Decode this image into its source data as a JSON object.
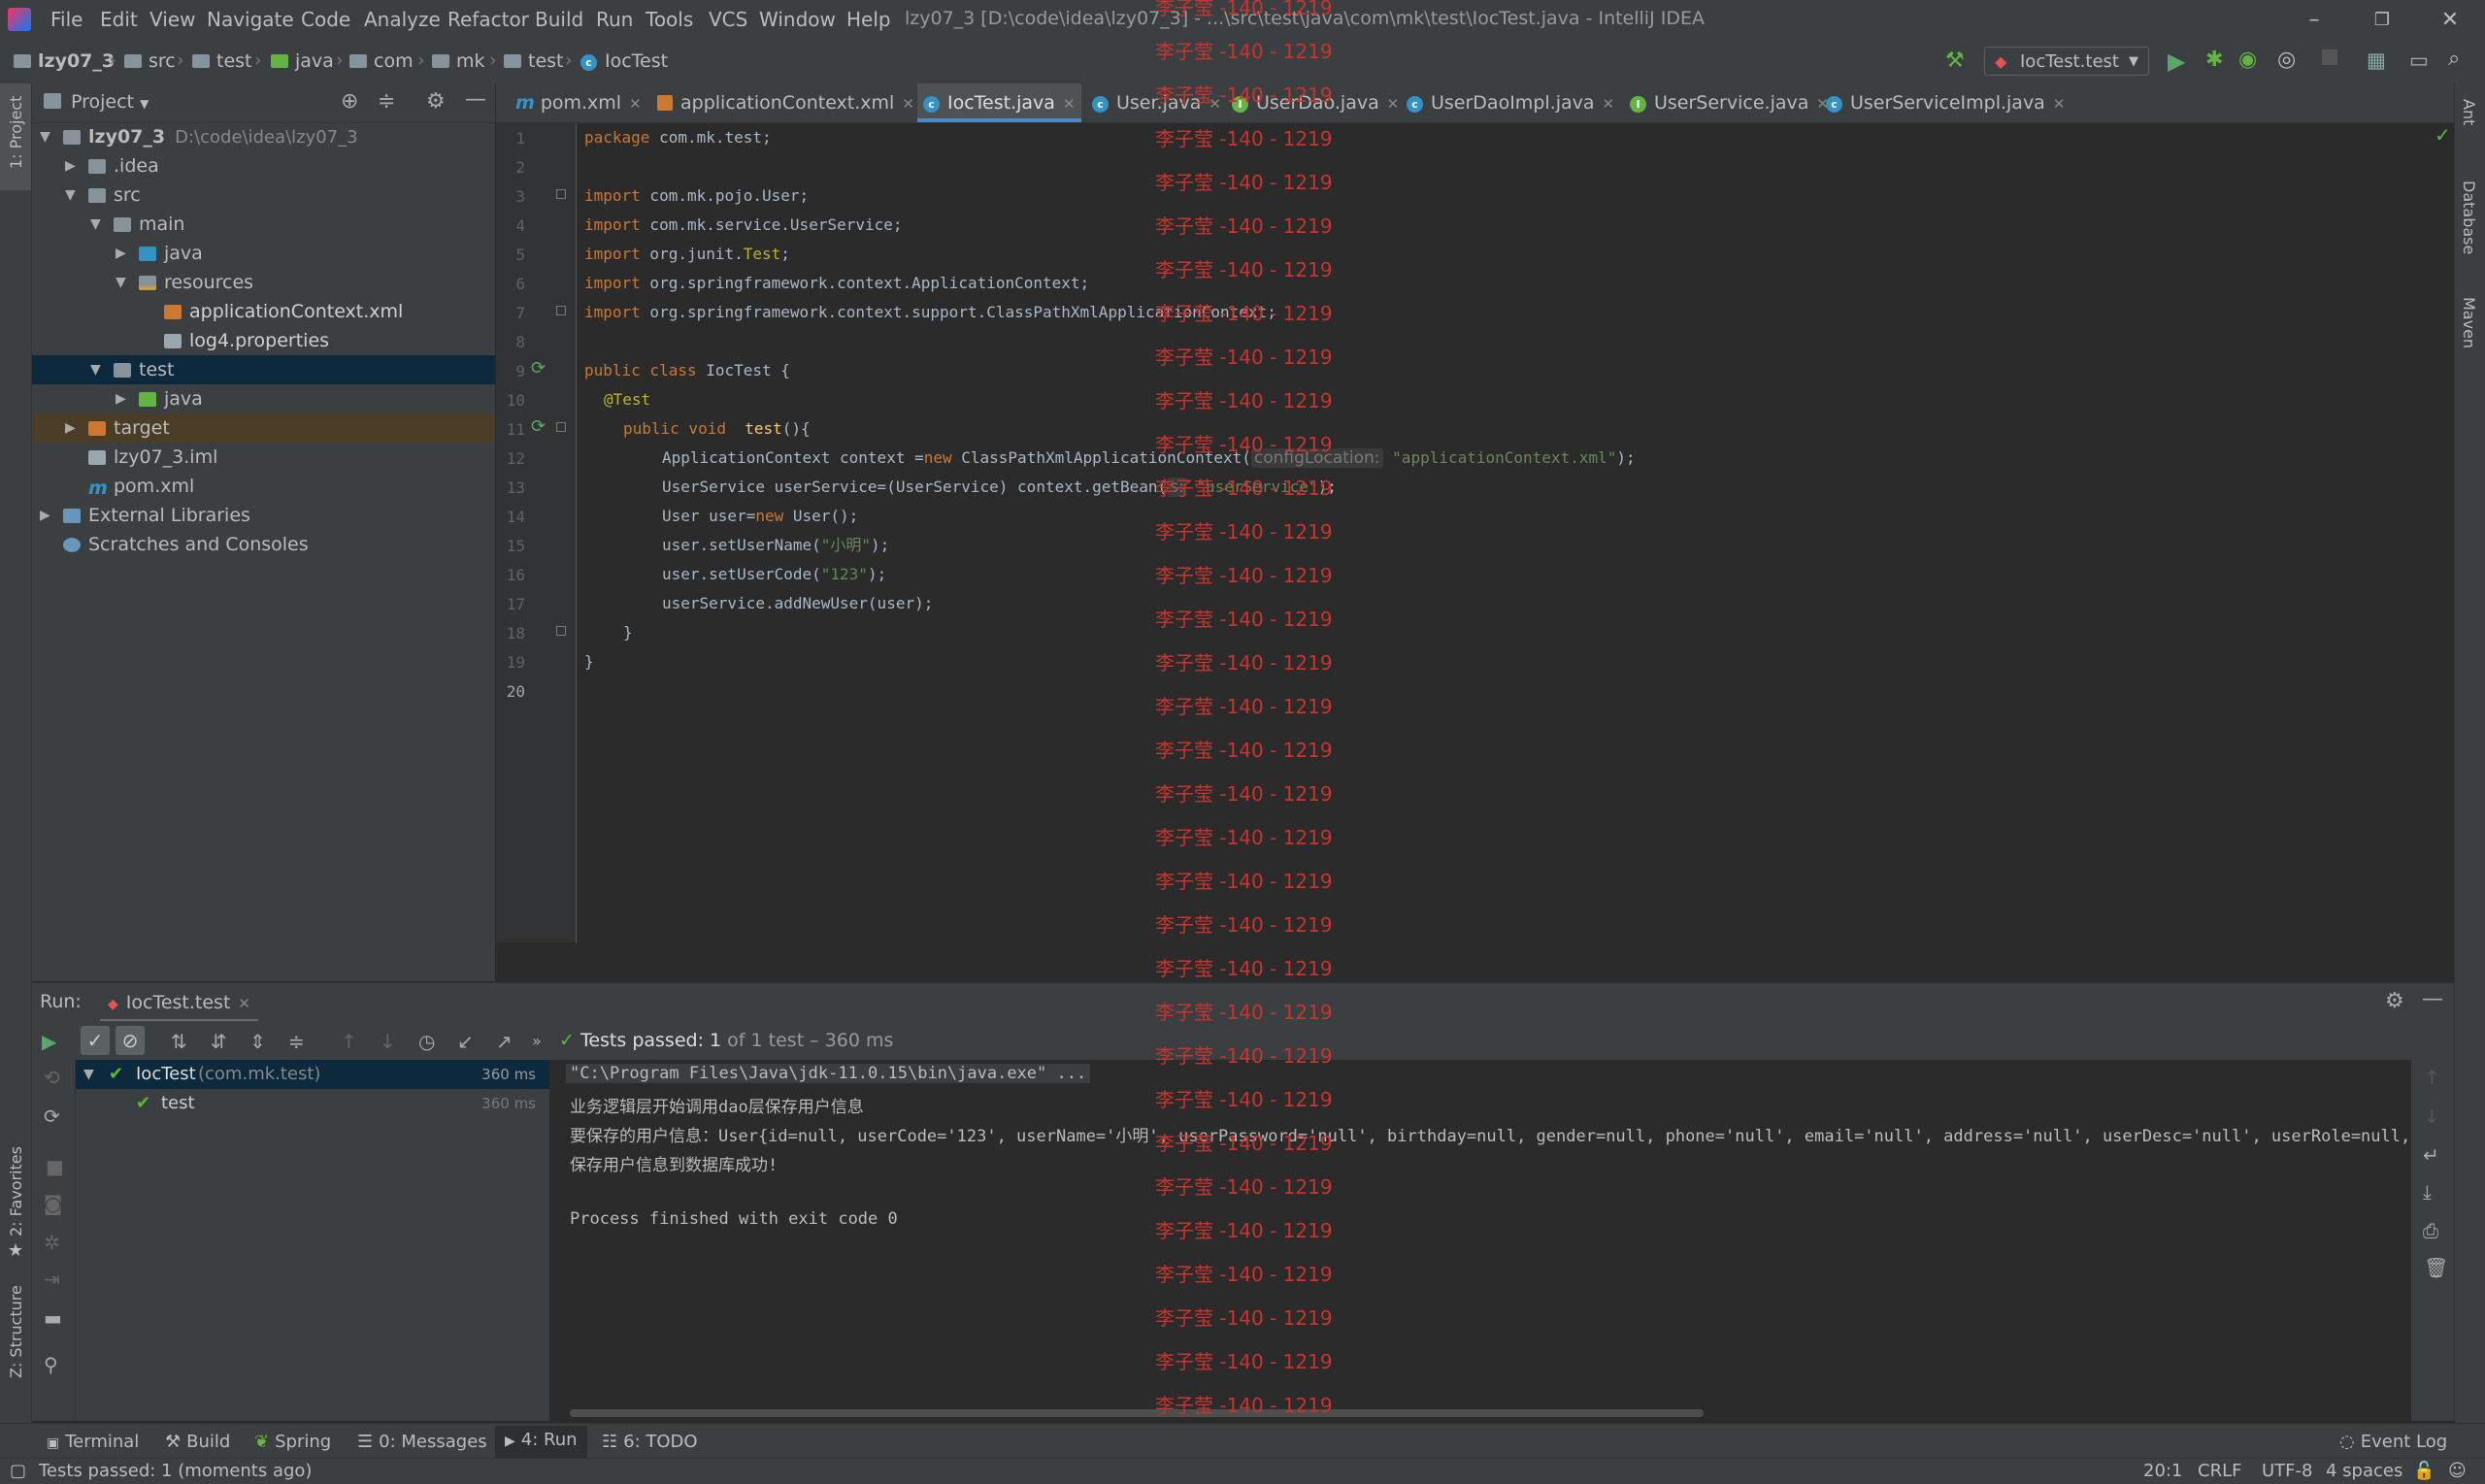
{
  "menu": {
    "items": [
      "File",
      "Edit",
      "View",
      "Navigate",
      "Code",
      "Analyze",
      "Refactor",
      "Build",
      "Run",
      "Tools",
      "VCS",
      "Window",
      "Help"
    ],
    "window_title": "lzy07_3 [D:\\code\\idea\\lzy07_3] - ...\\src\\test\\java\\com\\mk\\test\\IocTest.java - IntelliJ IDEA"
  },
  "breadcrumb": [
    "lzy07_3",
    "src",
    "test",
    "java",
    "com",
    "mk",
    "test",
    "IocTest"
  ],
  "run_config": "IocTest.test",
  "project_panel": {
    "title": "Project",
    "tree": [
      {
        "label": "lzy07_3",
        "extra": "D:\\code\\idea\\lzy07_3",
        "indent": 0,
        "arrow": "down",
        "icon": "module-folder-icon"
      },
      {
        "label": ".idea",
        "indent": 1,
        "arrow": "right",
        "icon": "folder-icon"
      },
      {
        "label": "src",
        "indent": 1,
        "arrow": "down",
        "icon": "folder-icon"
      },
      {
        "label": "main",
        "indent": 2,
        "arrow": "down",
        "icon": "folder-icon"
      },
      {
        "label": "java",
        "indent": 3,
        "arrow": "right",
        "icon": "source-folder-icon"
      },
      {
        "label": "resources",
        "indent": 3,
        "arrow": "down",
        "icon": "resources-folder-icon"
      },
      {
        "label": "applicationContext.xml",
        "indent": 4,
        "arrow": "",
        "icon": "xml-file-icon"
      },
      {
        "label": "log4.properties",
        "indent": 4,
        "arrow": "",
        "icon": "properties-file-icon"
      },
      {
        "label": "test",
        "indent": 2,
        "arrow": "down",
        "icon": "folder-icon"
      },
      {
        "label": "java",
        "indent": 3,
        "arrow": "right",
        "icon": "test-folder-icon"
      },
      {
        "label": "target",
        "indent": 1,
        "arrow": "right",
        "icon": "excluded-folder-icon"
      },
      {
        "label": "lzy07_3.iml",
        "indent": 1,
        "arrow": "",
        "icon": "iml-file-icon"
      },
      {
        "label": "pom.xml",
        "indent": 1,
        "arrow": "",
        "icon": "maven-file-icon"
      },
      {
        "label": "External Libraries",
        "indent": 0,
        "arrow": "right",
        "icon": "libraries-icon"
      },
      {
        "label": "Scratches and Consoles",
        "indent": 0,
        "arrow": "",
        "icon": "scratches-icon"
      }
    ]
  },
  "editor_tabs": [
    {
      "label": "pom.xml",
      "icon": "maven"
    },
    {
      "label": "applicationContext.xml",
      "icon": "xml"
    },
    {
      "label": "IocTest.java",
      "icon": "class",
      "active": true
    },
    {
      "label": "User.java",
      "icon": "class"
    },
    {
      "label": "UserDao.java",
      "icon": "interface"
    },
    {
      "label": "UserDaoImpl.java",
      "icon": "class"
    },
    {
      "label": "UserService.java",
      "icon": "interface"
    },
    {
      "label": "UserServiceImpl.java",
      "icon": "class"
    }
  ],
  "code": {
    "line_numbers": [
      "1",
      "2",
      "3",
      "4",
      "5",
      "6",
      "7",
      "8",
      "9",
      "10",
      "11",
      "12",
      "13",
      "14",
      "15",
      "16",
      "17",
      "18",
      "19",
      "20"
    ],
    "l1_kw": "package",
    "l1_rest": " com.mk.test;",
    "l3_kw": "import",
    "l3_rest": " com.mk.pojo.User;",
    "l4_kw": "import",
    "l4_rest": " com.mk.service.UserService;",
    "l5_kw": "import",
    "l5_rest": " org.junit.",
    "l5_an": "Test",
    "l5_end": ";",
    "l6_kw": "import",
    "l6_rest": " org.springframework.context.ApplicationContext;",
    "l7_kw": "import",
    "l7_rest": " org.springframework.context.support.ClassPathXmlApplicationContext;",
    "l9_kw": "public class",
    "l9_rest": " IocTest {",
    "l10": "@Test",
    "l11_kw": "public void",
    "l11_fn": "test",
    "l11_rest": "(){",
    "l12_a": "ApplicationContext context =",
    "l12_kw": "new",
    "l12_b": " ClassPathXmlApplicationContext(",
    "l12_hint": "configLocation:",
    "l12_str": "\"applicationContext.xml\"",
    "l12_end": ");",
    "l13_a": "UserService userService=(UserService) context.getBean(",
    "l13_hint": "s:",
    "l13_str": "\"userService\"",
    "l13_end": ");",
    "l14_a": "User user=",
    "l14_kw": "new",
    "l14_b": " User();",
    "l15_a": "user.setUserName(",
    "l15_str": "\"小明\"",
    "l15_end": ");",
    "l16_a": "user.setUserCode(",
    "l16_str": "\"123\"",
    "l16_end": ");",
    "l17": "userService.addNewUser(user);",
    "l18": "}",
    "l19": "}"
  },
  "run": {
    "label": "Run:",
    "tab": "IocTest.test",
    "status_passed": "Tests passed:",
    "status_count": "1",
    "status_rest": "of 1 test – 360 ms",
    "tree": [
      {
        "name": "IocTest",
        "pkg": "(com.mk.test)",
        "time": "360 ms"
      },
      {
        "name": "test",
        "pkg": "",
        "time": "360 ms"
      }
    ],
    "console": [
      "\"C:\\Program Files\\Java\\jdk-11.0.15\\bin\\java.exe\" ...",
      "业务逻辑层开始调用dao层保存用户信息",
      "要保存的用户信息：User{id=null, userCode='123', userName='小明', userPassword='null', birthday=null, gender=null, phone='null', email='null', address='null', userDesc='null', userRole=null, c",
      "保存用户信息到数据库成功!",
      "",
      "Process finished with exit code 0"
    ]
  },
  "tool_tabs": [
    {
      "label": "Terminal"
    },
    {
      "label": "Build"
    },
    {
      "label": "Spring"
    },
    {
      "label": "0: Messages"
    },
    {
      "label": "4: Run"
    },
    {
      "label": "6: TODO"
    }
  ],
  "event_log": "Event Log",
  "side_labels": {
    "project": "1: Project",
    "favorites": "2: Favorites",
    "structure": "Z: Structure",
    "ant": "Ant",
    "database": "Database",
    "maven": "Maven"
  },
  "status": {
    "message": "Tests passed: 1 (moments ago)",
    "position": "20:1",
    "line_sep": "CRLF",
    "encoding": "UTF-8",
    "indent": "4 spaces"
  },
  "watermark": "李子莹 -140 - 1219",
  "colors": {
    "accent": "#4a88c7",
    "keyword": "#cc7832",
    "string": "#6a8759",
    "annotation": "#bbb529",
    "watermark": "#c8342e",
    "pass": "#5fb832"
  }
}
